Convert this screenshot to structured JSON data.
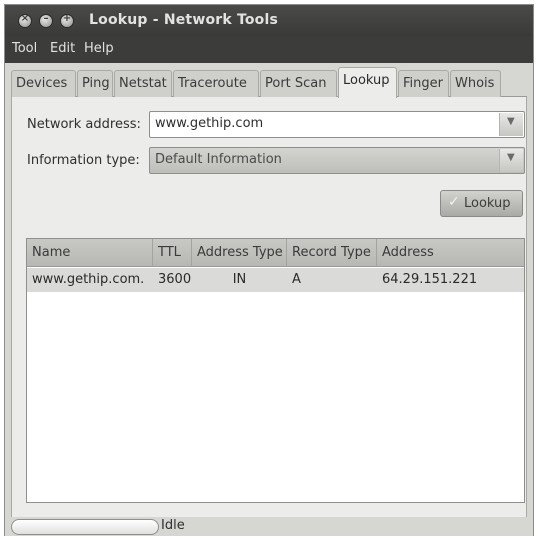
{
  "window": {
    "title": "Lookup - Network Tools"
  },
  "menubar": {
    "items": [
      "Tool",
      "Edit",
      "Help"
    ]
  },
  "tabs": [
    {
      "label": "Devices",
      "active": false
    },
    {
      "label": "Ping",
      "active": false
    },
    {
      "label": "Netstat",
      "active": false
    },
    {
      "label": "Traceroute",
      "active": false
    },
    {
      "label": "Port Scan",
      "active": false
    },
    {
      "label": "Lookup",
      "active": true
    },
    {
      "label": "Finger",
      "active": false
    },
    {
      "label": "Whois",
      "active": false
    }
  ],
  "form": {
    "address_label": "Network address:",
    "address_value": "www.gethip.com",
    "info_label": "Information type:",
    "info_value": "Default Information",
    "lookup_button": "Lookup"
  },
  "results": {
    "columns": [
      "Name",
      "TTL",
      "Address Type",
      "Record Type",
      "Address"
    ],
    "rows": [
      [
        "www.gethip.com.",
        "3600",
        "IN",
        "A",
        "64.29.151.221"
      ]
    ]
  },
  "status": {
    "text": "Idle"
  },
  "icons": {
    "close": "close-icon",
    "minimize": "minimize-icon",
    "maximize": "maximize-icon",
    "dropdown": "chevron-down-icon",
    "lookup": "check-icon"
  }
}
